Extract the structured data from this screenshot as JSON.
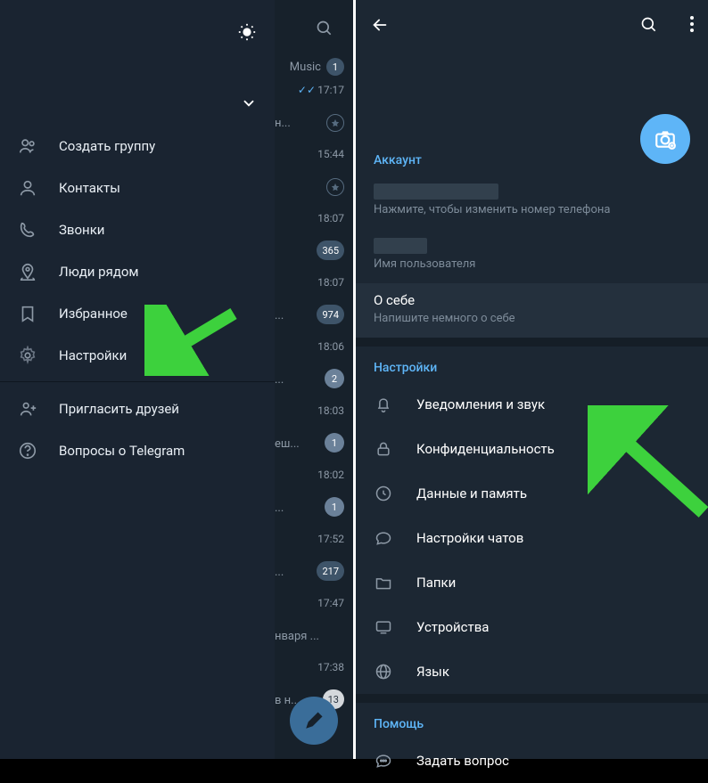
{
  "drawer": {
    "items": [
      {
        "icon": "group",
        "label": "Создать группу"
      },
      {
        "icon": "contact",
        "label": "Контакты"
      },
      {
        "icon": "phone",
        "label": "Звонки"
      },
      {
        "icon": "nearby",
        "label": "Люди рядом"
      },
      {
        "icon": "bookmark",
        "label": "Избранное"
      },
      {
        "icon": "gear",
        "label": "Настройки"
      }
    ],
    "footer": [
      {
        "icon": "invite",
        "label": "Пригласить друзей"
      },
      {
        "icon": "help",
        "label": "Вопросы о Telegram"
      }
    ]
  },
  "chats": {
    "music_label": "Music",
    "music_badge": "1",
    "rows": [
      {
        "time": "17:17",
        "txt": "н...",
        "checks": true,
        "pin": true
      },
      {
        "time": "15:44",
        "txt": "",
        "pin": true
      },
      {
        "time": "18:07",
        "txt": "",
        "badge": "365"
      },
      {
        "time": "18:07",
        "txt": "...",
        "badge": "974"
      },
      {
        "time": "18:06",
        "txt": "...",
        "badge": "2",
        "darkbadge": true
      },
      {
        "time": "18:03",
        "txt": "еш...",
        "badge": "1",
        "darkbadge": true
      },
      {
        "time": "18:02",
        "txt": "...",
        "badge": "1",
        "darkbadge": true
      },
      {
        "time": "17:52",
        "txt": "...",
        "badge": "217"
      },
      {
        "time": "17:47",
        "txt": "нваря ..."
      },
      {
        "time": "17:38",
        "txt": "в н...",
        "badge": "13",
        "lightbadge": true
      }
    ]
  },
  "settings": {
    "account_title": "Аккаунт",
    "phone_hint": "Нажмите, чтобы изменить номер телефона",
    "username_hint": "Имя пользователя",
    "bio_label": "О себе",
    "bio_hint": "Напишите немного о себе",
    "settings_title": "Настройки",
    "items": [
      {
        "icon": "bell",
        "label": "Уведомления и звук"
      },
      {
        "icon": "lock",
        "label": "Конфиденциальность"
      },
      {
        "icon": "data",
        "label": "Данные и память"
      },
      {
        "icon": "chat",
        "label": "Настройки чатов"
      },
      {
        "icon": "folder",
        "label": "Папки"
      },
      {
        "icon": "device",
        "label": "Устройства"
      },
      {
        "icon": "globe",
        "label": "Язык"
      }
    ],
    "help_title": "Помощь",
    "help_item": "Задать вопрос"
  }
}
